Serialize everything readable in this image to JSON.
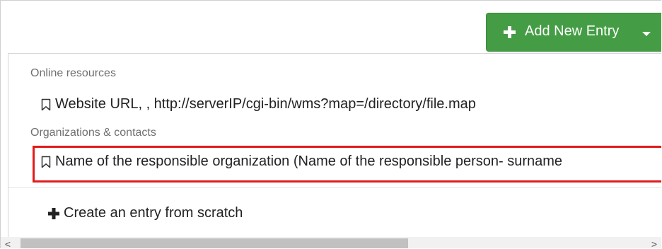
{
  "add_button": {
    "label": "Add New Entry",
    "color": "#449d44"
  },
  "menu": {
    "sections": [
      {
        "header": "Online resources",
        "items": [
          {
            "label": "Website URL, , http://serverIP/cgi-bin/wms?map=/directory/file.map",
            "icon": "bookmark-icon"
          }
        ]
      },
      {
        "header": "Organizations & contacts",
        "items": [
          {
            "label": "Name of the responsible organization (Name of the responsible person- surname",
            "icon": "bookmark-icon",
            "highlighted": true
          }
        ]
      }
    ],
    "create_label": "Create an entry from scratch",
    "highlight_color": "#e11b1b"
  },
  "scrollbar": {
    "left_arrow": "<",
    "right_arrow": ">"
  }
}
